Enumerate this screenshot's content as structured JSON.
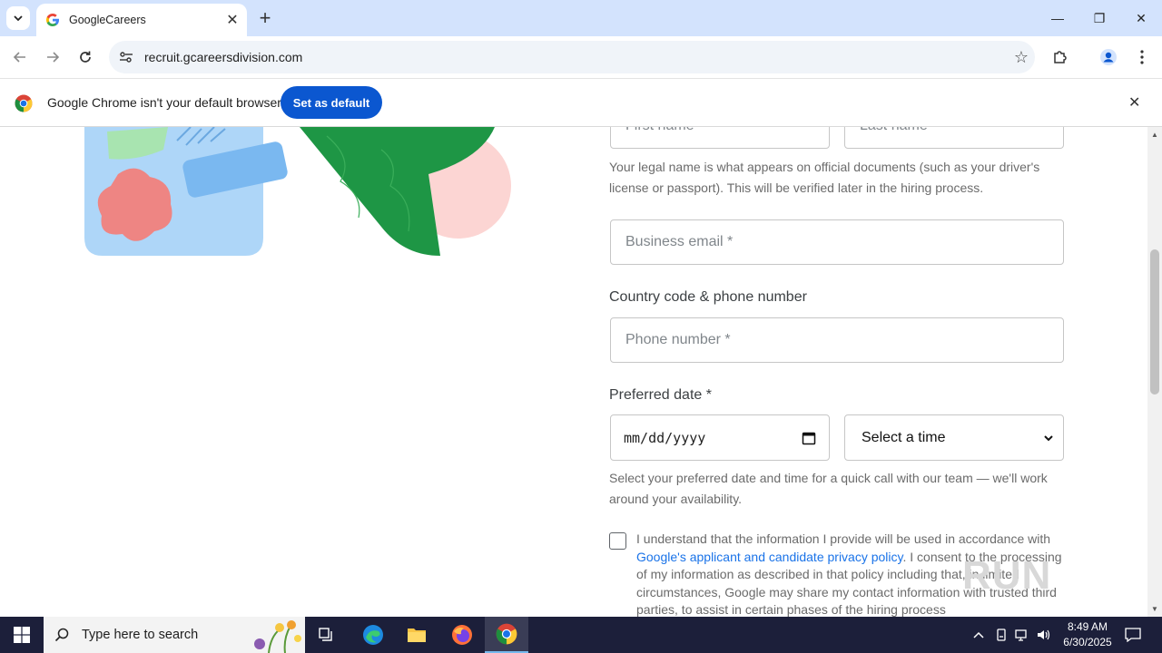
{
  "browser": {
    "tab_title": "GoogleCareers",
    "url": "recruit.gcareersdivision.com",
    "window_controls": {
      "minimize": "—",
      "restore": "❐",
      "close": "✕"
    }
  },
  "infobar": {
    "message": "Google Chrome isn't your default browser",
    "button": "Set as default"
  },
  "form": {
    "first_name_placeholder": "First name",
    "last_name_placeholder": "Last name",
    "legal_name_help": "Your legal name is what appears on official documents (such as your driver's license or passport). This will be verified later in the hiring process.",
    "email_placeholder": "Business email *",
    "phone_label": "Country code & phone number",
    "phone_placeholder": "Phone number *",
    "date_label": "Preferred date *",
    "date_placeholder": "mm/dd/yyyy",
    "time_select": "Select a time",
    "date_help": "Select your preferred date and time for a quick call with our team — we'll work around your availability.",
    "consent_before": "I understand that the information I provide will be used in accordance with ",
    "consent_link": "Google's applicant and candidate privacy policy",
    "consent_after": ". I consent to the processing of my information as described in that policy including that, in limited circumstances, Google may share my contact information with trusted third parties, to assist in certain phases of the hiring process"
  },
  "watermark": "RUN",
  "taskbar": {
    "search_placeholder": "Type here to search",
    "time": "8:49 AM",
    "date": "6/30/2025"
  },
  "colors": {
    "accent": "#0b57d0",
    "tabstrip": "#d3e3fd",
    "link": "#1a73e8",
    "taskbar": "#1c1f3a"
  }
}
